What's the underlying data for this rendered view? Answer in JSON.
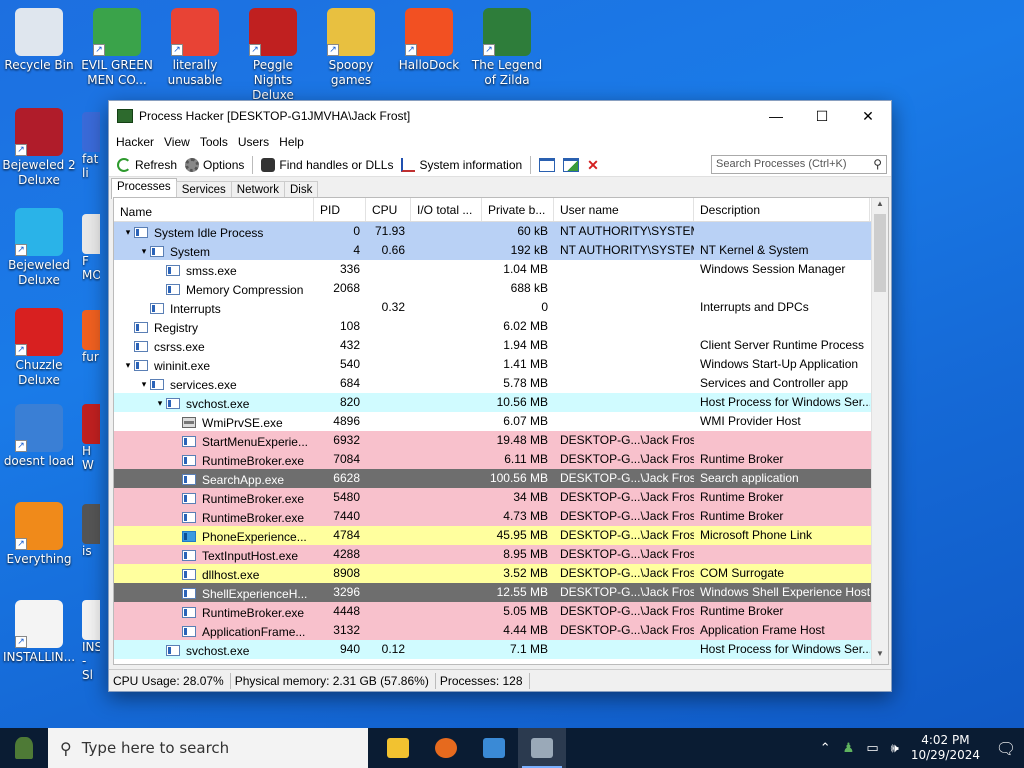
{
  "desktop": {
    "icons": [
      {
        "label": "Recycle Bin",
        "color": "#dfe6ee"
      },
      {
        "label": "EVIL GREEN MEN CO...",
        "color": "#3aa34a"
      },
      {
        "label": "literally unusable",
        "color": "#e84335"
      },
      {
        "label": "Peggle Nights Deluxe",
        "color": "#c02020"
      },
      {
        "label": "Spoopy games",
        "color": "#e8c040"
      },
      {
        "label": "HalloDock",
        "color": "#f25022"
      },
      {
        "label": "The Legend of Zilda",
        "color": "#2e7d3a"
      },
      {
        "label": "Bejeweled 2 Deluxe",
        "color": "#b01c2a"
      },
      {
        "label": "Bejeweled Deluxe",
        "color": "#2ab3e8"
      },
      {
        "label": "Chuzzle Deluxe",
        "color": "#d82020"
      },
      {
        "label": "doesnt load",
        "color": "#3a7fd5"
      },
      {
        "label": "Everything",
        "color": "#f08a1a"
      },
      {
        "label": "INSTALLIN...",
        "color": "#f4f4f4"
      }
    ],
    "partial_labels": [
      "fat li",
      "F MON",
      "fur",
      "H W",
      "is",
      "INST - Sl"
    ]
  },
  "window": {
    "title": "Process Hacker [DESKTOP-G1JMVHA\\Jack Frost]",
    "minimize": "—",
    "maximize": "☐",
    "close": "✕",
    "menu": [
      "Hacker",
      "View",
      "Tools",
      "Users",
      "Help"
    ],
    "toolbar": {
      "refresh": "Refresh",
      "options": "Options",
      "find_handles": "Find handles or DLLs",
      "system_info": "System information",
      "search_placeholder": "Search Processes (Ctrl+K)"
    },
    "tabs": [
      "Processes",
      "Services",
      "Network",
      "Disk"
    ],
    "columns": [
      "Name",
      "PID",
      "CPU",
      "I/O total ...",
      "Private b...",
      "User name",
      "Description"
    ],
    "rows": [
      {
        "name": "System Idle Process",
        "depth": 0,
        "exp": "v",
        "pid": "0",
        "cpu": "71.93",
        "io": "",
        "priv": "60 kB",
        "user": "NT AUTHORITY\\SYSTEM",
        "desc": "",
        "bg": "#b9d1f5",
        "fg": "#000"
      },
      {
        "name": "System",
        "depth": 1,
        "exp": "v",
        "pid": "4",
        "cpu": "0.66",
        "io": "",
        "priv": "192 kB",
        "user": "NT AUTHORITY\\SYSTEM",
        "desc": "NT Kernel & System",
        "bg": "#b9d1f5",
        "fg": "#000"
      },
      {
        "name": "smss.exe",
        "depth": 2,
        "exp": "",
        "pid": "336",
        "cpu": "",
        "io": "",
        "priv": "1.04 MB",
        "user": "",
        "desc": "Windows Session Manager",
        "bg": "#ffffff",
        "fg": "#000"
      },
      {
        "name": "Memory Compression",
        "depth": 2,
        "exp": "",
        "pid": "2068",
        "cpu": "",
        "io": "",
        "priv": "688 kB",
        "user": "",
        "desc": "",
        "bg": "#ffffff",
        "fg": "#000"
      },
      {
        "name": "Interrupts",
        "depth": 1,
        "exp": "",
        "pid": "",
        "cpu": "0.32",
        "io": "",
        "priv": "0",
        "user": "",
        "desc": "Interrupts and DPCs",
        "bg": "#ffffff",
        "fg": "#000"
      },
      {
        "name": "Registry",
        "depth": 0,
        "exp": "",
        "pid": "108",
        "cpu": "",
        "io": "",
        "priv": "6.02 MB",
        "user": "",
        "desc": "",
        "bg": "#ffffff",
        "fg": "#000"
      },
      {
        "name": "csrss.exe",
        "depth": 0,
        "exp": "",
        "pid": "432",
        "cpu": "",
        "io": "",
        "priv": "1.94 MB",
        "user": "",
        "desc": "Client Server Runtime Process",
        "bg": "#ffffff",
        "fg": "#000"
      },
      {
        "name": "wininit.exe",
        "depth": 0,
        "exp": "v",
        "pid": "540",
        "cpu": "",
        "io": "",
        "priv": "1.41 MB",
        "user": "",
        "desc": "Windows Start-Up Application",
        "bg": "#ffffff",
        "fg": "#000"
      },
      {
        "name": "services.exe",
        "depth": 1,
        "exp": "v",
        "pid": "684",
        "cpu": "",
        "io": "",
        "priv": "5.78 MB",
        "user": "",
        "desc": "Services and Controller app",
        "bg": "#ffffff",
        "fg": "#000"
      },
      {
        "name": "svchost.exe",
        "depth": 2,
        "exp": "v",
        "pid": "820",
        "cpu": "",
        "io": "",
        "priv": "10.56 MB",
        "user": "",
        "desc": "Host Process for Windows Ser...",
        "bg": "#d0fbff",
        "fg": "#000"
      },
      {
        "name": "WmiPrvSE.exe",
        "depth": 3,
        "exp": "",
        "pid": "4896",
        "cpu": "",
        "io": "",
        "priv": "6.07 MB",
        "user": "",
        "desc": "WMI Provider Host",
        "bg": "#ffffff",
        "fg": "#000",
        "icon": "cog"
      },
      {
        "name": "StartMenuExperie...",
        "depth": 3,
        "exp": "",
        "pid": "6932",
        "cpu": "",
        "io": "",
        "priv": "19.48 MB",
        "user": "DESKTOP-G...\\Jack Frost",
        "desc": "",
        "bg": "#f8c1cc",
        "fg": "#000"
      },
      {
        "name": "RuntimeBroker.exe",
        "depth": 3,
        "exp": "",
        "pid": "7084",
        "cpu": "",
        "io": "",
        "priv": "6.11 MB",
        "user": "DESKTOP-G...\\Jack Frost",
        "desc": "Runtime Broker",
        "bg": "#f8c1cc",
        "fg": "#000"
      },
      {
        "name": "SearchApp.exe",
        "depth": 3,
        "exp": "",
        "pid": "6628",
        "cpu": "",
        "io": "",
        "priv": "100.56 MB",
        "user": "DESKTOP-G...\\Jack Frost",
        "desc": "Search application",
        "bg": "#6e6e6e",
        "fg": "#ffffff"
      },
      {
        "name": "RuntimeBroker.exe",
        "depth": 3,
        "exp": "",
        "pid": "5480",
        "cpu": "",
        "io": "",
        "priv": "34 MB",
        "user": "DESKTOP-G...\\Jack Frost",
        "desc": "Runtime Broker",
        "bg": "#f8c1cc",
        "fg": "#000"
      },
      {
        "name": "RuntimeBroker.exe",
        "depth": 3,
        "exp": "",
        "pid": "7440",
        "cpu": "",
        "io": "",
        "priv": "4.73 MB",
        "user": "DESKTOP-G...\\Jack Frost",
        "desc": "Runtime Broker",
        "bg": "#f8c1cc",
        "fg": "#000"
      },
      {
        "name": "PhoneExperience...",
        "depth": 3,
        "exp": "",
        "pid": "4784",
        "cpu": "",
        "io": "",
        "priv": "45.95 MB",
        "user": "DESKTOP-G...\\Jack Frost",
        "desc": "Microsoft Phone Link",
        "bg": "#ffff9e",
        "fg": "#000",
        "icon": "phone"
      },
      {
        "name": "TextInputHost.exe",
        "depth": 3,
        "exp": "",
        "pid": "4288",
        "cpu": "",
        "io": "",
        "priv": "8.95 MB",
        "user": "DESKTOP-G...\\Jack Frost",
        "desc": "",
        "bg": "#f8c1cc",
        "fg": "#000"
      },
      {
        "name": "dllhost.exe",
        "depth": 3,
        "exp": "",
        "pid": "8908",
        "cpu": "",
        "io": "",
        "priv": "3.52 MB",
        "user": "DESKTOP-G...\\Jack Frost",
        "desc": "COM Surrogate",
        "bg": "#ffff9e",
        "fg": "#000"
      },
      {
        "name": "ShellExperienceH...",
        "depth": 3,
        "exp": "",
        "pid": "3296",
        "cpu": "",
        "io": "",
        "priv": "12.55 MB",
        "user": "DESKTOP-G...\\Jack Frost",
        "desc": "Windows Shell Experience Host",
        "bg": "#6e6e6e",
        "fg": "#ffffff"
      },
      {
        "name": "RuntimeBroker.exe",
        "depth": 3,
        "exp": "",
        "pid": "4448",
        "cpu": "",
        "io": "",
        "priv": "5.05 MB",
        "user": "DESKTOP-G...\\Jack Frost",
        "desc": "Runtime Broker",
        "bg": "#f8c1cc",
        "fg": "#000"
      },
      {
        "name": "ApplicationFrame...",
        "depth": 3,
        "exp": "",
        "pid": "3132",
        "cpu": "",
        "io": "",
        "priv": "4.44 MB",
        "user": "DESKTOP-G...\\Jack Frost",
        "desc": "Application Frame Host",
        "bg": "#f8c1cc",
        "fg": "#000"
      },
      {
        "name": "svchost.exe",
        "depth": 2,
        "exp": "",
        "pid": "940",
        "cpu": "0.12",
        "io": "",
        "priv": "7.1 MB",
        "user": "",
        "desc": "Host Process for Windows Ser...",
        "bg": "#d0fbff",
        "fg": "#000"
      }
    ],
    "status": {
      "cpu": "CPU Usage: 28.07%",
      "memory": "Physical memory: 2.31 GB (57.86%)",
      "processes": "Processes: 128"
    }
  },
  "taskbar": {
    "search_placeholder": "Type here to search",
    "apps": [
      {
        "name": "file-explorer",
        "color": "#f2c230"
      },
      {
        "name": "firefox",
        "color": "#e66a1e"
      },
      {
        "name": "control-panel",
        "color": "#3a8ad6"
      },
      {
        "name": "process-hacker",
        "color": "#9aa9b8"
      }
    ],
    "time": "4:02 PM",
    "date": "10/29/2024"
  }
}
